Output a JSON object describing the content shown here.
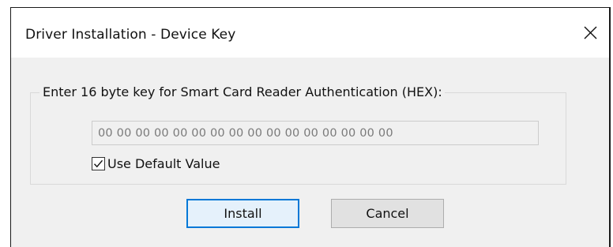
{
  "window": {
    "title": "Driver Installation - Device Key",
    "close_icon": "close-icon"
  },
  "group": {
    "label": "Enter 16 byte key for Smart Card Reader Authentication (HEX):"
  },
  "key_field": {
    "value": "00 00 00 00 00 00 00 00 00 00 00 00 00 00 00 00",
    "disabled": true
  },
  "default_checkbox": {
    "label": "Use Default Value",
    "checked": true,
    "icon": "checkmark-icon"
  },
  "buttons": {
    "install_label": "Install",
    "cancel_label": "Cancel"
  },
  "colors": {
    "accent": "#0078d7",
    "dialog_bg": "#f0f0f0",
    "titlebar_bg": "#ffffff"
  }
}
